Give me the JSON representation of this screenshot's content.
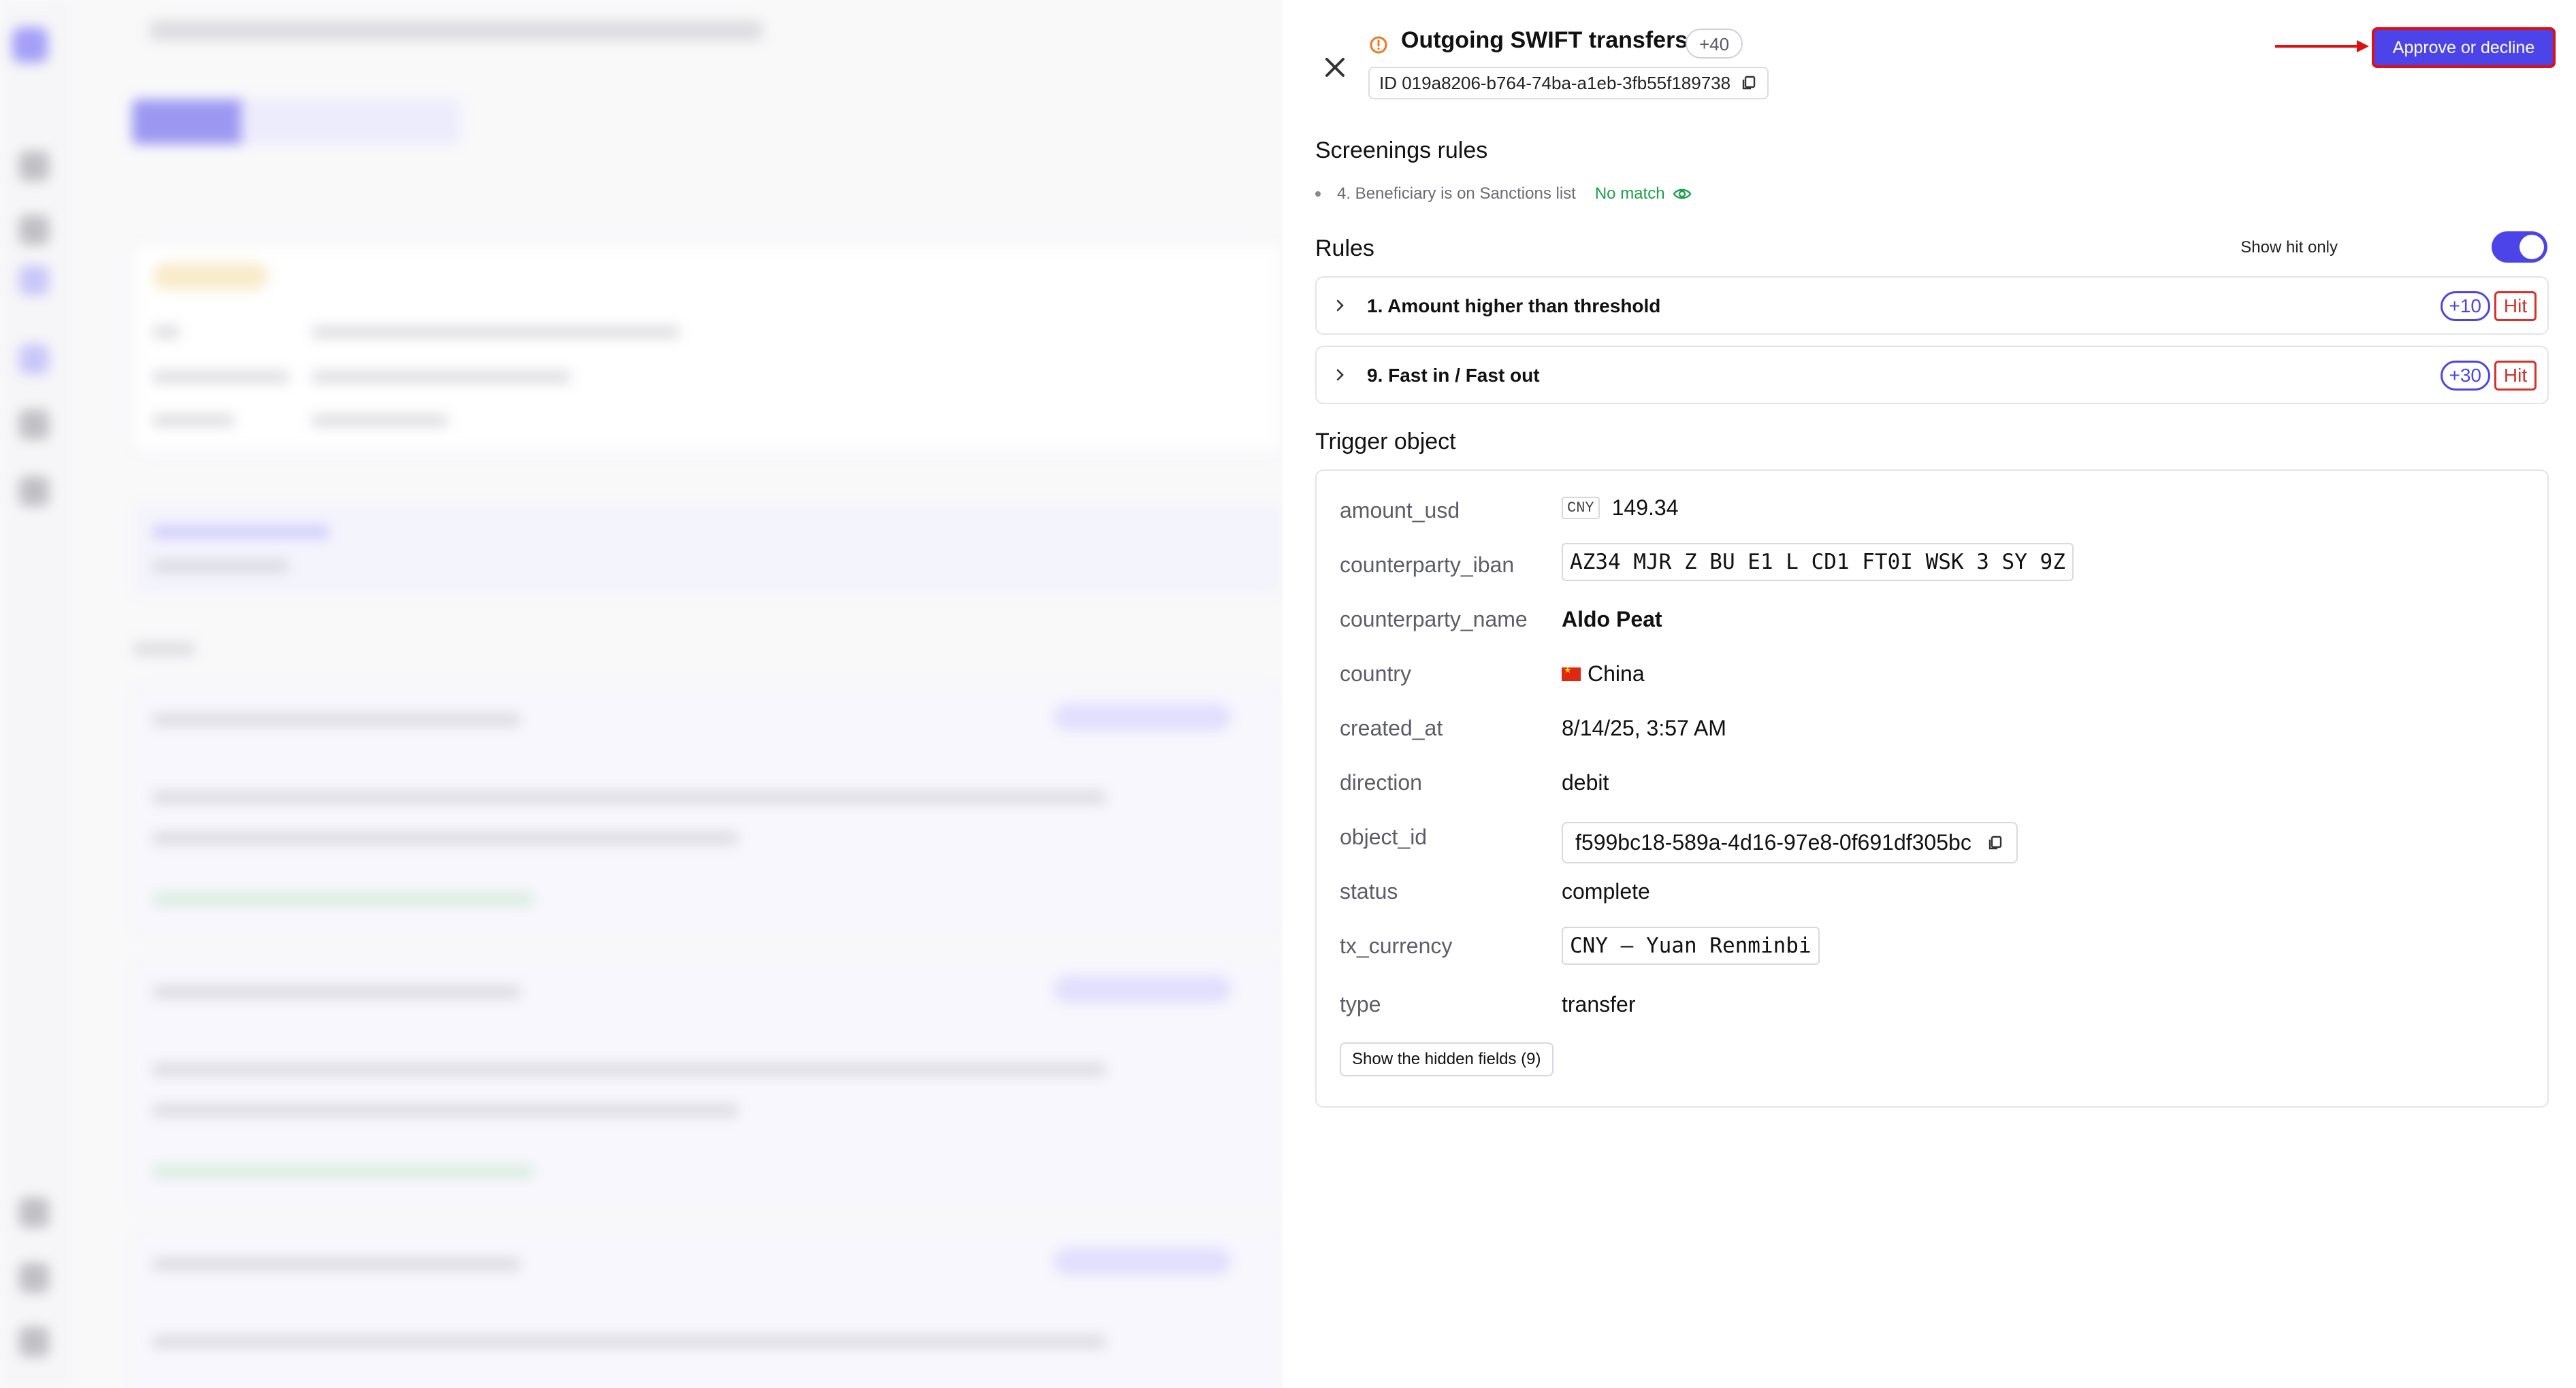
{
  "header": {
    "title": "Outgoing SWIFT transfers",
    "score": "+40",
    "id_text": "ID 019a8206-b764-74ba-a1eb-3fb55f189738",
    "approve_label": "Approve or decline"
  },
  "screenings": {
    "title": "Screenings rules",
    "items": [
      {
        "label": "4. Beneficiary is on Sanctions list",
        "status": "No match"
      }
    ]
  },
  "rules": {
    "title": "Rules",
    "show_hit_label": "Show hit only",
    "show_hit_on": true,
    "items": [
      {
        "name": "1. Amount higher than threshold",
        "score": "+10",
        "hit": "Hit"
      },
      {
        "name": "9. Fast in / Fast out",
        "score": "+30",
        "hit": "Hit"
      }
    ]
  },
  "trigger": {
    "title": "Trigger object",
    "fields": {
      "amount_usd": {
        "label": "amount_usd",
        "currency_tag": "CNY",
        "value": "149.34"
      },
      "counterparty_iban": {
        "label": "counterparty_iban",
        "value": "AZ34 MJR Z BU E1 L CD1 FT0I WSK 3 SY 9Z"
      },
      "counterparty_name": {
        "label": "counterparty_name",
        "value": "Aldo Peat"
      },
      "country": {
        "label": "country",
        "value": "China"
      },
      "created_at": {
        "label": "created_at",
        "value": "8/14/25, 3:57 AM"
      },
      "direction": {
        "label": "direction",
        "value": "debit"
      },
      "object_id": {
        "label": "object_id",
        "value": "f599bc18-589a-4d16-97e8-0f691df305bc"
      },
      "status": {
        "label": "status",
        "value": "complete"
      },
      "tx_currency": {
        "label": "tx_currency",
        "value": "CNY – Yuan Renminbi"
      },
      "type": {
        "label": "type",
        "value": "transfer"
      }
    },
    "hidden_fields_label": "Show the hidden fields (9)"
  },
  "colors": {
    "accent": "#4c44e8",
    "hit": "#d9302a",
    "no_match": "#1ca04a",
    "annotation": "#e01010"
  }
}
